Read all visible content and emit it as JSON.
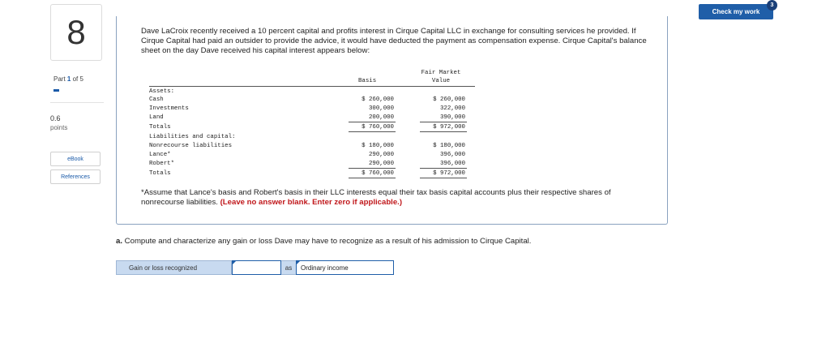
{
  "sidebar": {
    "question_number": "8",
    "part_prefix": "Part ",
    "part_current": "1",
    "part_suffix": " of 5",
    "part_progress": 0.2,
    "points_value": "0.6",
    "points_label": "points",
    "ebook_label": "eBook",
    "references_label": "References"
  },
  "header": {
    "check_label": "Check my work",
    "check_badge": "3"
  },
  "question": {
    "intro": "Dave LaCroix recently received a 10 percent capital and profits interest in Cirque Capital LLC in exchange for consulting services he provided. If Cirque Capital had paid an outsider to provide the advice, it would have deducted the payment as compensation expense. Cirque Capital's balance sheet on the day Dave received his capital interest appears below:",
    "note_text": "*Assume that Lance's basis and Robert's basis in their LLC interests equal their tax basis capital accounts plus their respective shares of nonrecourse liabilities. ",
    "note_bold": "(Leave no answer blank. Enter zero if applicable.)",
    "part_a_prefix": "a.",
    "part_a_text": " Compute and characterize any gain or loss Dave may have to recognize as a result of his admission to Cirque Capital."
  },
  "balance_sheet": {
    "header_basis": "Basis",
    "header_fmv_line1": "Fair Market",
    "header_fmv_line2": "Value",
    "rows": [
      {
        "label": "Assets:",
        "basis": "",
        "fmv": ""
      },
      {
        "label": "Cash",
        "basis": "$ 260,000",
        "fmv": "$ 260,000"
      },
      {
        "label": "Investments",
        "basis": "300,000",
        "fmv": "322,000"
      },
      {
        "label": "Land",
        "basis": "200,000",
        "fmv": "390,000"
      },
      {
        "label": "Totals",
        "basis": "$ 760,000",
        "fmv": "$ 972,000"
      },
      {
        "label": "Liabilities and capital:",
        "basis": "",
        "fmv": ""
      },
      {
        "label": "Nonrecourse liabilities",
        "basis": "$ 180,000",
        "fmv": "$ 180,000"
      },
      {
        "label": "Lance*",
        "basis": "290,000",
        "fmv": "396,000"
      },
      {
        "label": "Robert*",
        "basis": "290,000",
        "fmv": "396,000"
      },
      {
        "label": "Totals",
        "basis": "$ 760,000",
        "fmv": "$ 972,000"
      }
    ]
  },
  "answer": {
    "label": "Gain or loss recognized",
    "input_value": "",
    "as_label": "as",
    "select_value": "Ordinary income"
  }
}
